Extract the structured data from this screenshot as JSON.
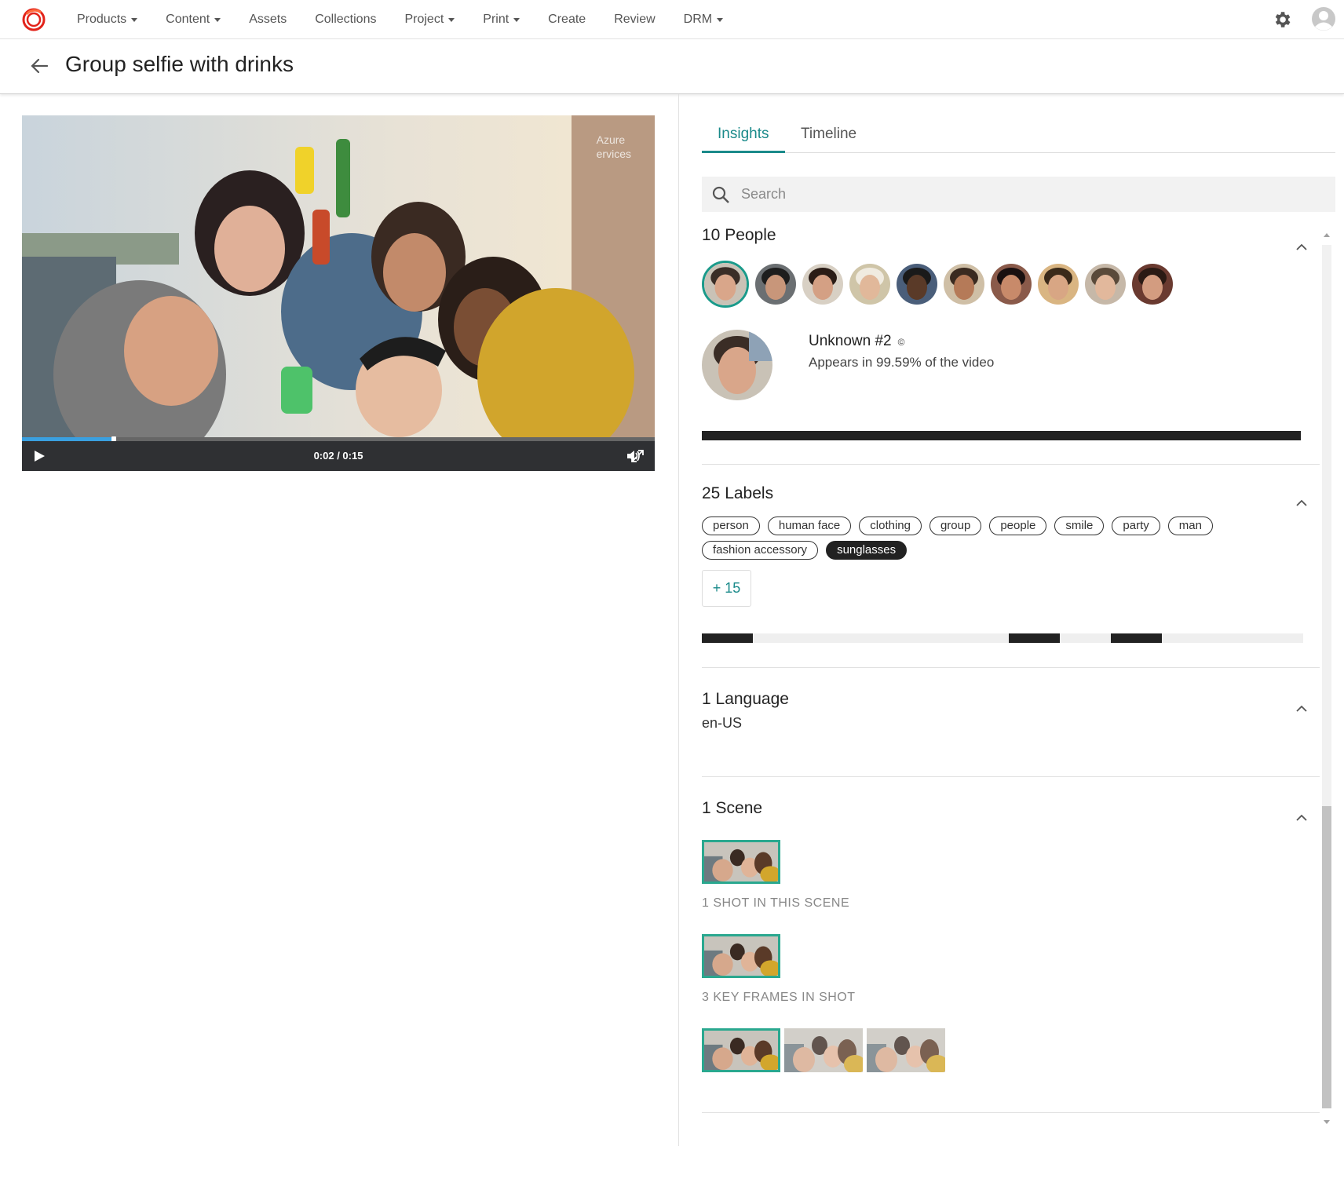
{
  "nav": {
    "items": [
      {
        "label": "Products",
        "dropdown": true
      },
      {
        "label": "Content",
        "dropdown": true
      },
      {
        "label": "Assets",
        "dropdown": false
      },
      {
        "label": "Collections",
        "dropdown": false
      },
      {
        "label": "Project",
        "dropdown": true
      },
      {
        "label": "Print",
        "dropdown": true
      },
      {
        "label": "Create",
        "dropdown": false
      },
      {
        "label": "Review",
        "dropdown": false
      },
      {
        "label": "DRM",
        "dropdown": true
      }
    ],
    "icons": [
      "logo-icon",
      "gear-icon",
      "user-avatar-icon"
    ],
    "brand_color": "#e2231a"
  },
  "header": {
    "title": "Group selfie with drinks",
    "back_icon": "arrow-left-icon"
  },
  "video": {
    "watermark_line1": "Azure",
    "watermark_line2": "ervices",
    "time": "0:02 / 0:15",
    "progress_fraction": 0.145,
    "icons": [
      "play-icon",
      "volume-icon",
      "fullscreen-icon"
    ]
  },
  "tabs": [
    {
      "label": "Insights",
      "active": true
    },
    {
      "label": "Timeline",
      "active": false
    }
  ],
  "search": {
    "placeholder": "Search",
    "value": ""
  },
  "people": {
    "title": "10 People",
    "count": 10,
    "selected_index": 0,
    "selected": {
      "name": "Unknown #2",
      "appears": "Appears in 99.59% of the video",
      "coverage_fraction": 0.9959
    }
  },
  "labels": {
    "title": "25 Labels",
    "chips": [
      {
        "text": "person",
        "selected": false
      },
      {
        "text": "human face",
        "selected": false
      },
      {
        "text": "clothing",
        "selected": false
      },
      {
        "text": "group",
        "selected": false
      },
      {
        "text": "people",
        "selected": false
      },
      {
        "text": "smile",
        "selected": false
      },
      {
        "text": "party",
        "selected": false
      },
      {
        "text": "man",
        "selected": false
      },
      {
        "text": "fashion accessory",
        "selected": false
      },
      {
        "text": "sunglasses",
        "selected": true
      }
    ],
    "more": "+ 15",
    "timeline_segments": [
      {
        "start": 0.0,
        "end": 0.085
      },
      {
        "start": 0.51,
        "end": 0.595
      },
      {
        "start": 0.68,
        "end": 0.765
      }
    ]
  },
  "language": {
    "title": "1 Language",
    "value": "en-US"
  },
  "scene": {
    "title": "1 Scene",
    "shots_caption": "1 SHOT IN THIS SCENE",
    "keyframes_caption": "3 KEY FRAMES IN SHOT",
    "keyframe_count": 3
  },
  "colors": {
    "accent": "#1a8a8a",
    "selection_border": "#2aa88f"
  }
}
